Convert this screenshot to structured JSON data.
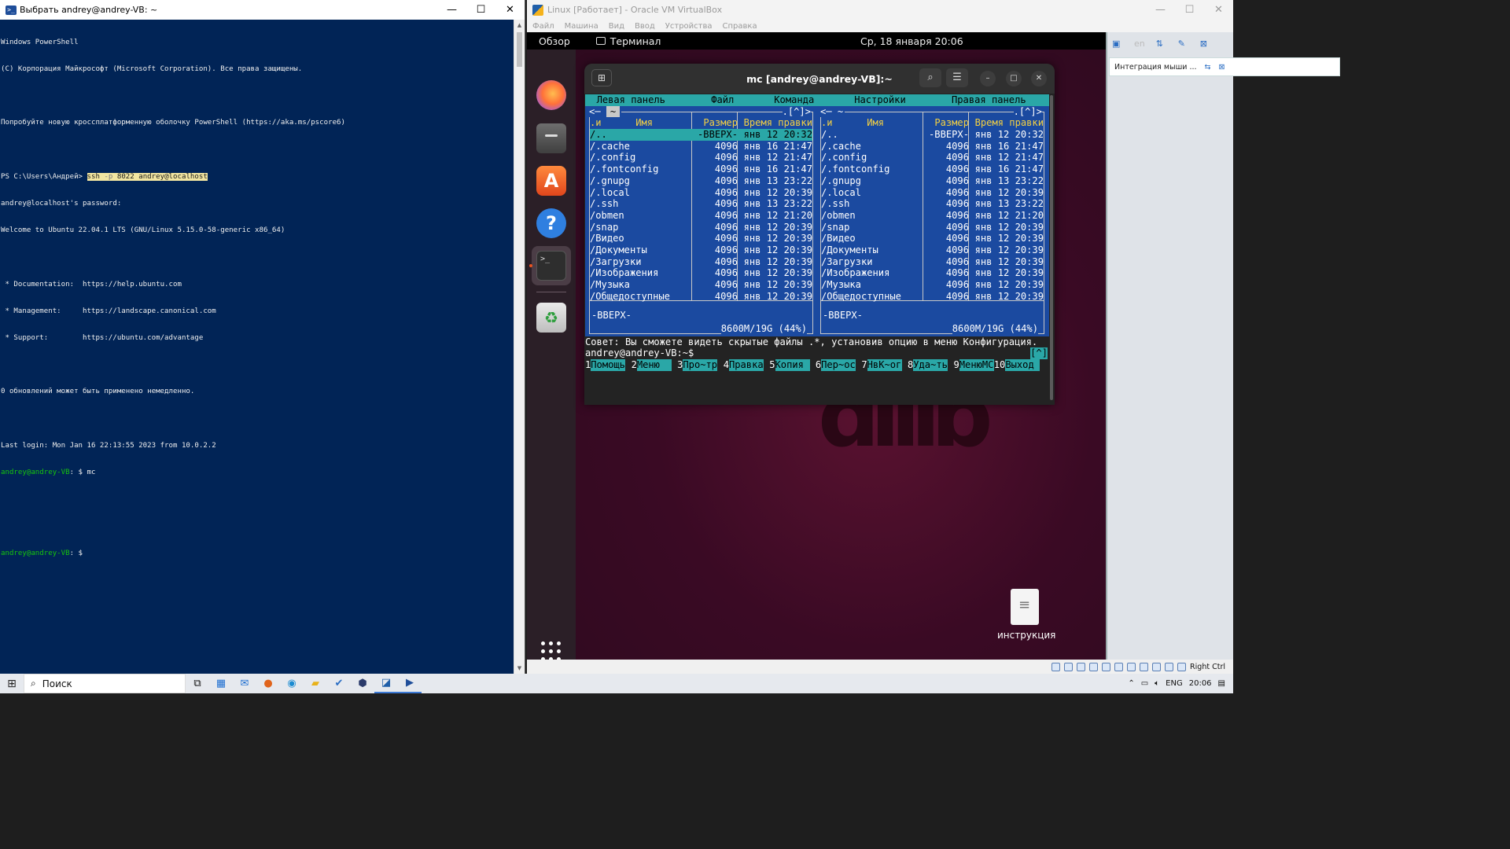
{
  "powershell": {
    "title": "Выбрать andrey@andrey-VB: ~",
    "lines": [
      {
        "text": "Windows PowerShell"
      },
      {
        "text": "(C) Корпорация Майкрософт (Microsoft Corporation). Все права защищены."
      },
      {
        "text": ""
      },
      {
        "text": "Попробуйте новую кроссплатформенную оболочку PowerShell (https://aka.ms/pscore6)"
      },
      {
        "text": ""
      }
    ],
    "prompt_prefix": "PS C:\\Users\\Андрей> ",
    "cmd_ssh": "ssh",
    "cmd_param": "-p",
    "cmd_rest": "8022 andrey@localhost",
    "after_lines": [
      "andrey@localhost's password:",
      "Welcome to Ubuntu 22.04.1 LTS (GNU/Linux 5.15.0-58-generic x86_64)",
      "",
      " * Documentation:  https://help.ubuntu.com",
      " * Management:     https://landscape.canonical.com",
      " * Support:        https://ubuntu.com/advantage",
      "",
      "0 обновлений может быть применено немедленно.",
      "",
      "Last login: Mon Jan 16 22:13:55 2023 from 10.0.2.2"
    ],
    "user_host": "andrey@andrey-VB",
    "prompt_line1_rest": ": $ mc",
    "prompt_line2_rest": ": $"
  },
  "virtualbox": {
    "title": "Linux [Работает] - Oracle VM VirtualBox",
    "menu": [
      "Файл",
      "Машина",
      "Вид",
      "Ввод",
      "Устройства",
      "Справка"
    ],
    "side_lang": "en",
    "side_panel": "Интеграция мыши ...",
    "status_host_key": "Right Ctrl"
  },
  "gnome": {
    "overview": "Обзор",
    "app": "Терминал",
    "clock": "Ср, 18 января  20:06",
    "desktop_file": "инструкция"
  },
  "terminal": {
    "title": "mc [andrey@andrey-VB]:~"
  },
  "mc": {
    "menu": [
      "Левая панель",
      "Файл",
      "Команда",
      "Настройки",
      "Правая панель"
    ],
    "left_path": "~",
    "right_path": "~",
    "hist": ".[^]>",
    "headers": {
      "name_sort": ".и",
      "name": "Имя",
      "size": "Размер",
      "date": "Время правки"
    },
    "rows": [
      {
        "name": "/..",
        "size": "-ВВЕРХ-",
        "date": "янв 12 20:32"
      },
      {
        "name": "/.cache",
        "size": "4096",
        "date": "янв 16 21:47"
      },
      {
        "name": "/.config",
        "size": "4096",
        "date": "янв 12 21:47"
      },
      {
        "name": "/.fontconfig",
        "size": "4096",
        "date": "янв 16 21:47"
      },
      {
        "name": "/.gnupg",
        "size": "4096",
        "date": "янв 13 23:22"
      },
      {
        "name": "/.local",
        "size": "4096",
        "date": "янв 12 20:39"
      },
      {
        "name": "/.ssh",
        "size": "4096",
        "date": "янв 13 23:22"
      },
      {
        "name": "/obmen",
        "size": "4096",
        "date": "янв 12 21:20"
      },
      {
        "name": "/snap",
        "size": "4096",
        "date": "янв 12 20:39"
      },
      {
        "name": "/Видео",
        "size": "4096",
        "date": "янв 12 20:39"
      },
      {
        "name": "/Документы",
        "size": "4096",
        "date": "янв 12 20:39"
      },
      {
        "name": "/Загрузки",
        "size": "4096",
        "date": "янв 12 20:39"
      },
      {
        "name": "/Изображения",
        "size": "4096",
        "date": "янв 12 20:39"
      },
      {
        "name": "/Музыка",
        "size": "4096",
        "date": "янв 12 20:39"
      },
      {
        "name": "/Общедоступные",
        "size": "4096",
        "date": "янв 12 20:39"
      }
    ],
    "mini_status": "-ВВЕРХ-",
    "disk": "8600M/19G (44%)",
    "hint": "Совет: Вы сможете видеть скрытые файлы .*, установив опцию в меню Конфигурация.",
    "prompt": "andrey@andrey-VB:~$",
    "prompt_hist": "[^]",
    "fkeys": [
      {
        "n": "1",
        "label": "Помощь"
      },
      {
        "n": "2",
        "label": "Меню  "
      },
      {
        "n": "3",
        "label": "Про~тр"
      },
      {
        "n": "4",
        "label": "Правка"
      },
      {
        "n": "5",
        "label": "Копия "
      },
      {
        "n": "6",
        "label": "Пер~ос"
      },
      {
        "n": "7",
        "label": "НвК~ог"
      },
      {
        "n": "8",
        "label": "Уда~ть"
      },
      {
        "n": "9",
        "label": "МенюМС"
      },
      {
        "n": "10",
        "label": "Выход"
      }
    ]
  },
  "taskbar": {
    "search": "Поиск",
    "lang": "ENG",
    "time": "20:06"
  }
}
